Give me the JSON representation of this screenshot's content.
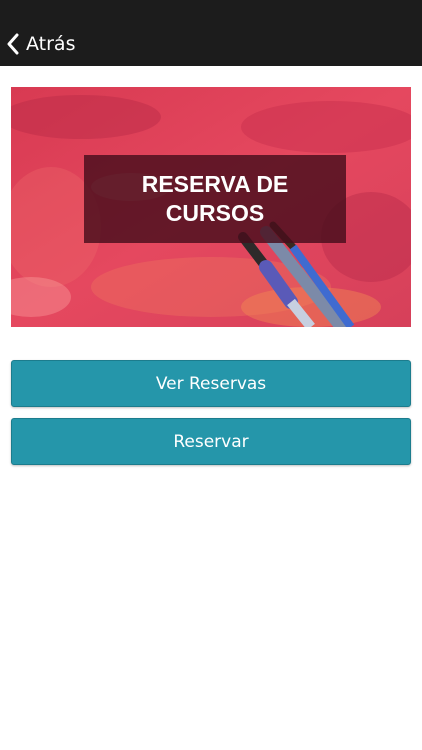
{
  "nav": {
    "back_label": "Atrás",
    "back_icon": "chevron-left-icon"
  },
  "banner": {
    "title_line1": "RESERVA DE",
    "title_line2": "CURSOS",
    "image": "painted-canvas-with-brushes"
  },
  "actions": {
    "view_bookings_label": "Ver Reservas",
    "book_label": "Reservar"
  },
  "colors": {
    "nav_bar": "#1c1c1c",
    "button": "#2596aa",
    "banner_base": "#e04660"
  }
}
